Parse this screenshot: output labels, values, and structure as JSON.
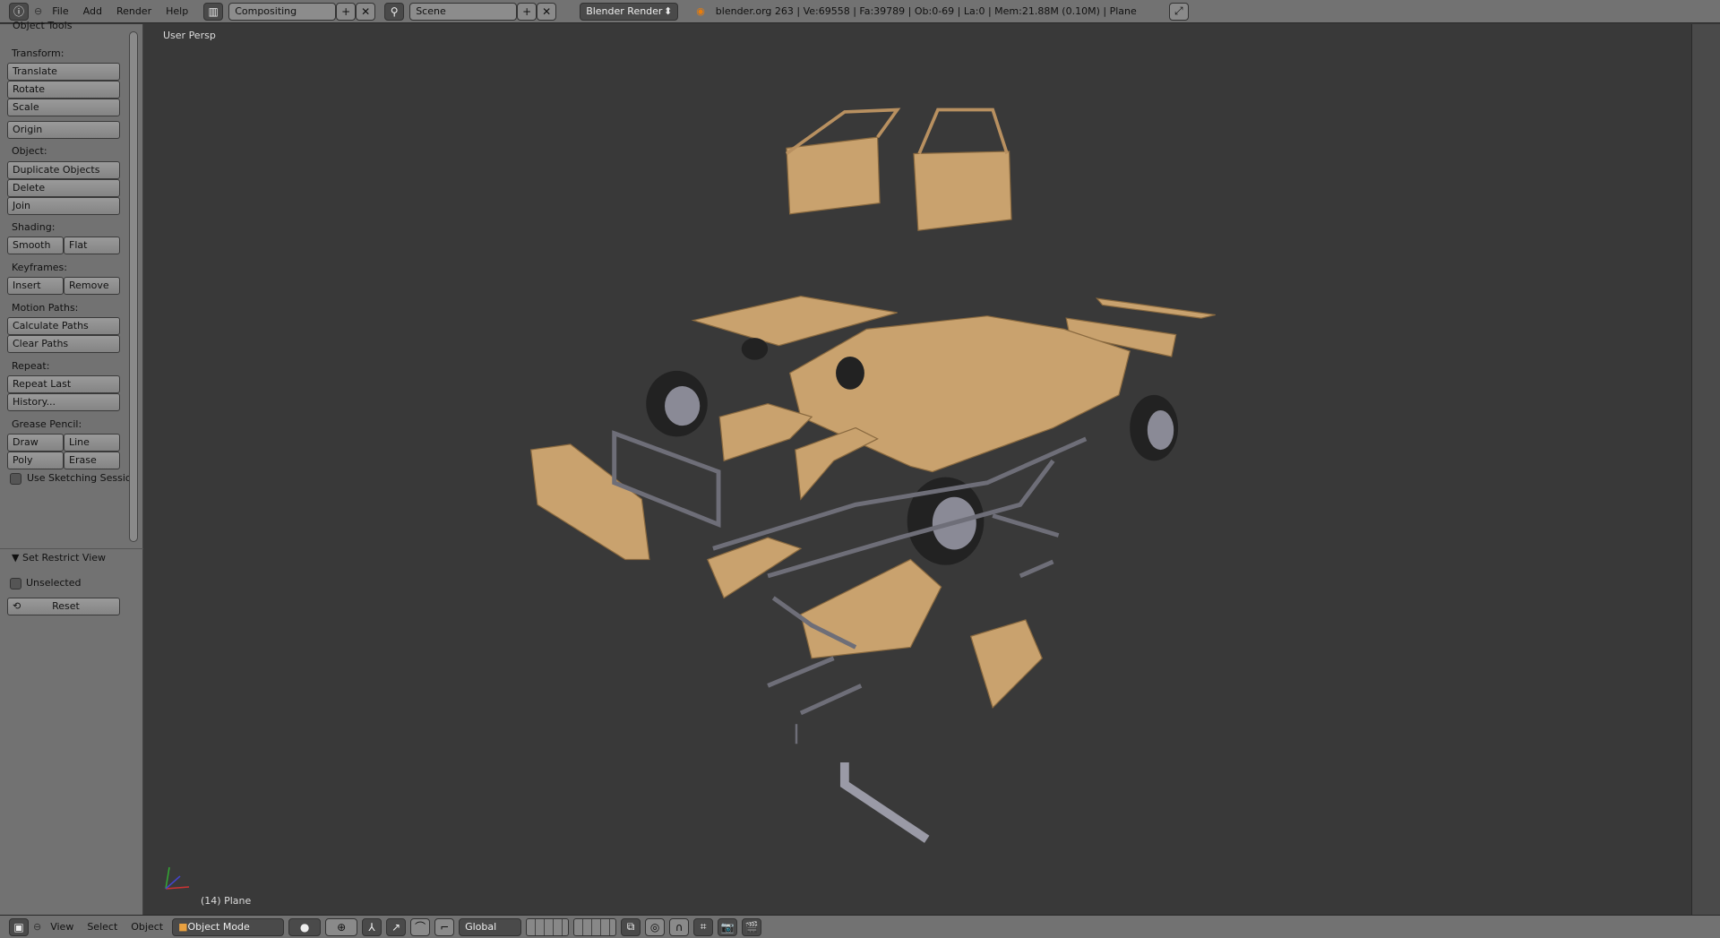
{
  "topbar": {
    "menus": [
      "File",
      "Add",
      "Render",
      "Help"
    ],
    "layout": "Compositing",
    "scene": "Scene",
    "engine": "Blender Render",
    "stats": "blender.org 263 | Ve:69558 | Fa:39789 | Ob:0-69 | La:0 | Mem:21.88M (0.10M) | Plane"
  },
  "toolpanel": {
    "title": "Object Tools",
    "transform_label": "Transform:",
    "translate": "Translate",
    "rotate": "Rotate",
    "scale": "Scale",
    "origin": "Origin",
    "object_label": "Object:",
    "duplicate": "Duplicate Objects",
    "delete": "Delete",
    "join": "Join",
    "shading_label": "Shading:",
    "smooth": "Smooth",
    "flat": "Flat",
    "keyframes_label": "Keyframes:",
    "insert": "Insert",
    "remove": "Remove",
    "motion_label": "Motion Paths:",
    "calc_paths": "Calculate Paths",
    "clear_paths": "Clear Paths",
    "repeat_label": "Repeat:",
    "repeat_last": "Repeat Last",
    "history": "History...",
    "grease_label": "Grease Pencil:",
    "draw": "Draw",
    "line": "Line",
    "poly": "Poly",
    "erase": "Erase",
    "sketching": "Use Sketching Sessio",
    "restrict_title": "Set Restrict View",
    "unselected": "Unselected",
    "reset": "Reset"
  },
  "viewport": {
    "view_name": "User Persp",
    "object_info": "(14) Plane"
  },
  "bottombar": {
    "menus": [
      "View",
      "Select",
      "Object"
    ],
    "mode": "Object Mode",
    "orientation": "Global"
  },
  "colors": {
    "body": "#c9a26e",
    "metal": "#8a8a96",
    "tire": "#2a2a2a",
    "bg": "#393939"
  }
}
